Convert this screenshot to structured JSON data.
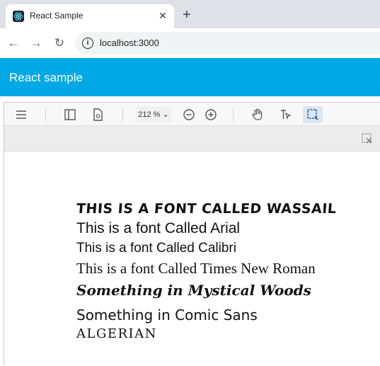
{
  "browser": {
    "tab": {
      "title": "React Sample",
      "close": "✕"
    },
    "new_tab": "+",
    "url": "localhost:3000"
  },
  "app": {
    "title": "React sample"
  },
  "viewer": {
    "zoom": "212 %",
    "page_lines": [
      "This is a font Called Wassail",
      "This is a font Called Arial",
      "This is a font Called Calibri",
      "This is a font Called Times New Roman",
      "Something in Mystical Woods",
      "Something in Comic Sans",
      "Algerian"
    ]
  },
  "colors": {
    "header": "#00a8e6",
    "tabstrip": "#dee1e6"
  }
}
